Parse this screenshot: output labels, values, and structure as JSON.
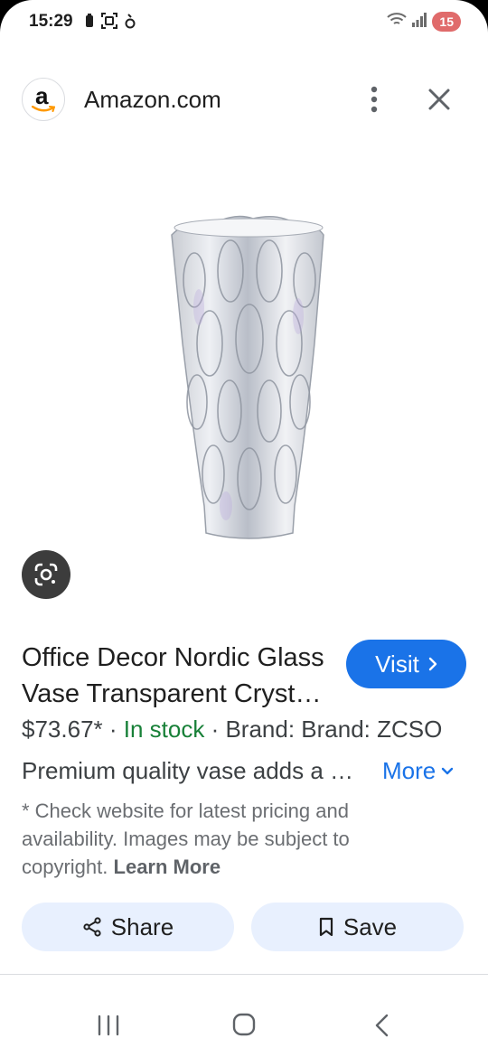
{
  "status_bar": {
    "time": "15:29",
    "battery_level": "15",
    "left_icons": [
      "battery-saver-icon",
      "screenshot-icon",
      "alarm-icon"
    ],
    "right_icons": [
      "wifi-icon",
      "signal-icon"
    ]
  },
  "header": {
    "site_logo_letter": "a",
    "site_name": "Amazon.com",
    "menu_icon": "more-vert-icon",
    "close_icon": "close-icon"
  },
  "product": {
    "title": "Office Decor Nordic Glass Vase Transparent Crystal Vase",
    "visit_label": "Visit",
    "price": "$73.67*",
    "separator": " · ",
    "stock": "In stock",
    "brand": "Brand: Brand: ZCSO",
    "description": "Premium quality vase adds a touch of elegance",
    "more_label": "More",
    "disclaimer": "* Check website for latest pricing and availability. Images may be subject to copyright.",
    "learn_more": "Learn More"
  },
  "actions": {
    "share_label": "Share",
    "save_label": "Save"
  },
  "colors": {
    "accent": "#1a73e8",
    "in_stock": "#188038",
    "chip_bg": "#e8f0fe",
    "battery_badge": "#e06b6b"
  }
}
